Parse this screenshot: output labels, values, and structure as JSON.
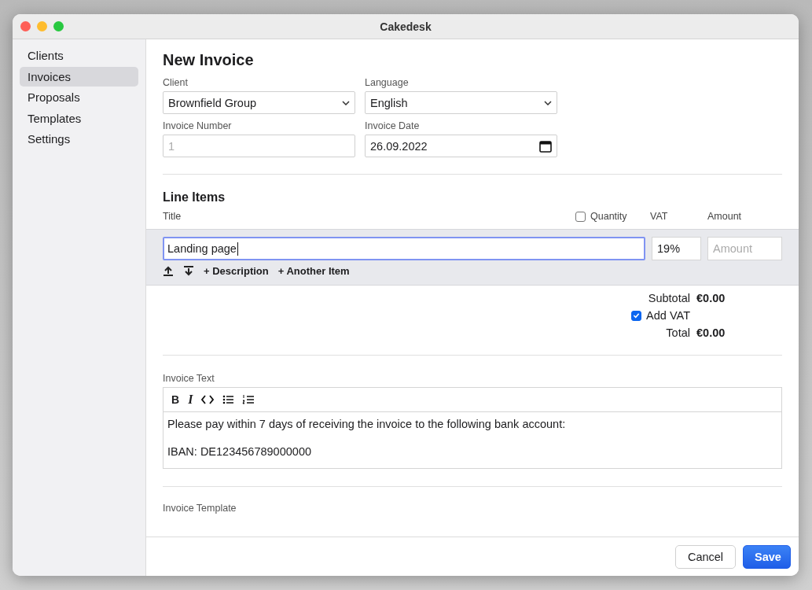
{
  "window": {
    "title": "Cakedesk"
  },
  "sidebar": {
    "items": [
      {
        "label": "Clients",
        "selected": false
      },
      {
        "label": "Invoices",
        "selected": true
      },
      {
        "label": "Proposals",
        "selected": false
      },
      {
        "label": "Templates",
        "selected": false
      },
      {
        "label": "Settings",
        "selected": false
      }
    ]
  },
  "form": {
    "heading": "New Invoice",
    "fields": [
      {
        "label": "Client",
        "kind": "select",
        "value": "Brownfield Group"
      },
      {
        "label": "Language",
        "kind": "select",
        "value": "English"
      },
      {
        "label": "Invoice Number",
        "kind": "text",
        "placeholder": "1"
      },
      {
        "label": "Invoice Date",
        "kind": "date",
        "value": "26.09.2022"
      }
    ]
  },
  "line_items": {
    "heading": "Line Items",
    "title_column": "Title",
    "quantity": {
      "label": "Quantity",
      "checked": false
    },
    "vat_column": "VAT",
    "amount_column": "Amount",
    "items": [
      {
        "title": "Landing page",
        "focused": true,
        "vat": "19%",
        "amount_placeholder": "Amount"
      }
    ],
    "actions": [
      "+ Description",
      "+ Another Item"
    ]
  },
  "totals": {
    "subtotal_label": "Subtotal",
    "subtotal": "€0.00",
    "add_vat": {
      "label": "Add VAT",
      "checked": true
    },
    "total_label": "Total",
    "total": "€0.00"
  },
  "invoice_text": {
    "label": "Invoice Text",
    "toolbar": [
      {
        "kind": "bold",
        "glyph": "B"
      },
      {
        "kind": "italic",
        "glyph": "I"
      },
      {
        "kind": "code"
      },
      {
        "kind": "bullet-list"
      },
      {
        "kind": "numbered-list"
      }
    ],
    "paragraphs": [
      "Please pay within 7 days of receiving the invoice to the following bank account:",
      "IBAN: DE123456789000000"
    ]
  },
  "invoice_template": {
    "label": "Invoice Template"
  },
  "buttons": [
    {
      "label": "Cancel",
      "kind": "secondary"
    },
    {
      "label": "Save",
      "kind": "primary"
    }
  ]
}
